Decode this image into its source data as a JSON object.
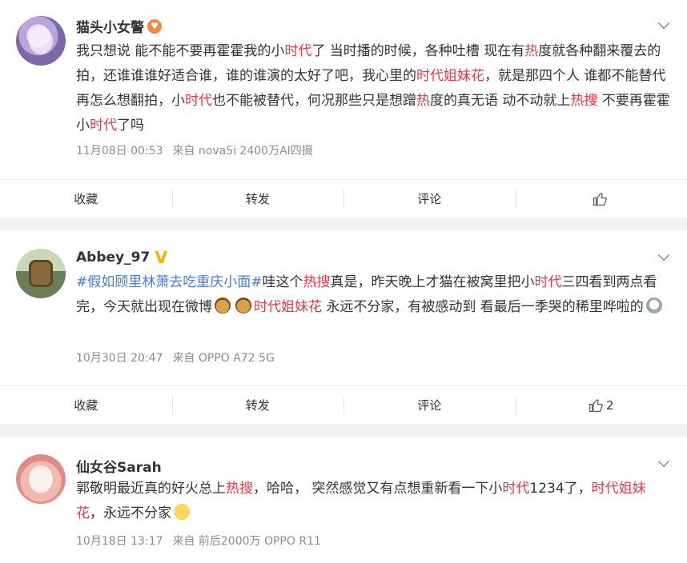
{
  "posts": [
    {
      "username": "猫头小女警",
      "badge": "♥",
      "segments": [
        {
          "t": "我只想说 能不能不要再霍霍我的小"
        },
        {
          "t": "时代",
          "hl": true
        },
        {
          "t": "了 当时播的时候，各种吐槽 现在有"
        },
        {
          "t": "热",
          "hl": true
        },
        {
          "t": "度就各种翻来覆去的拍，还谁谁谁好适合谁，谁的谁演的太好了吧，我心里的"
        },
        {
          "t": "时代姐妹花",
          "hl": true
        },
        {
          "t": "，就是那四个人 谁都不能替代 再怎么想翻拍，小"
        },
        {
          "t": "时代",
          "hl": true
        },
        {
          "t": "也不能被替代，何况那些只是想蹭"
        },
        {
          "t": "热",
          "hl": true
        },
        {
          "t": "度的真无语 动不动就上"
        },
        {
          "t": "热搜",
          "hl": true
        },
        {
          "t": " 不要再霍霍小"
        },
        {
          "t": "时代",
          "hl": true
        },
        {
          "t": "了吗"
        }
      ],
      "time": "11月08日 00:53",
      "source": "来自 nova5i 2400万AI四摄",
      "actions": {
        "collect": "收藏",
        "repost": "转发",
        "comment": "评论",
        "likes": ""
      }
    },
    {
      "username": "Abbey_97",
      "badge": "V",
      "segments": [
        {
          "t": "#假如顾里林萧去吃重庆小面#",
          "tag": true
        },
        {
          "t": "哇这个"
        },
        {
          "t": "热搜",
          "hl": true
        },
        {
          "t": "真是，昨天晚上才猫在被窝里把小"
        },
        {
          "t": "时代",
          "hl": true
        },
        {
          "t": "三四看到两点看完，今天就出现在微博"
        },
        {
          "emoji": "bear"
        },
        {
          "emoji": "bear"
        },
        {
          "t": "时代姐妹花",
          "hl": true
        },
        {
          "t": " 永远不分家，有被感动到 看最后一季哭的稀里哗啦的"
        },
        {
          "emoji": "ghost"
        }
      ],
      "time": "10月30日 20:47",
      "source": "来自 OPPO A72 5G",
      "actions": {
        "collect": "收藏",
        "repost": "转发",
        "comment": "评论",
        "likes": "2"
      }
    },
    {
      "username": "仙女谷Sarah",
      "badge": "",
      "segments": [
        {
          "t": "郭敬明最近真的好火总上"
        },
        {
          "t": "热搜",
          "hl": true
        },
        {
          "t": "，哈哈， 突然感觉又有点想重新看一下小"
        },
        {
          "t": "时代",
          "hl": true
        },
        {
          "t": "1234了，"
        },
        {
          "t": "时代姐妹花",
          "hl": true
        },
        {
          "t": "，永远不分家"
        },
        {
          "emoji": "fear"
        }
      ],
      "time": "10月18日 13:17",
      "source": "来自 前后2000万 OPPO R11"
    }
  ],
  "colors": {
    "highlight": "#e6394a",
    "topic": "#4a7bd6",
    "meta": "#8c8c8c"
  },
  "icons": {
    "more": "chevron-down-icon",
    "like": "thumb-up-icon"
  }
}
